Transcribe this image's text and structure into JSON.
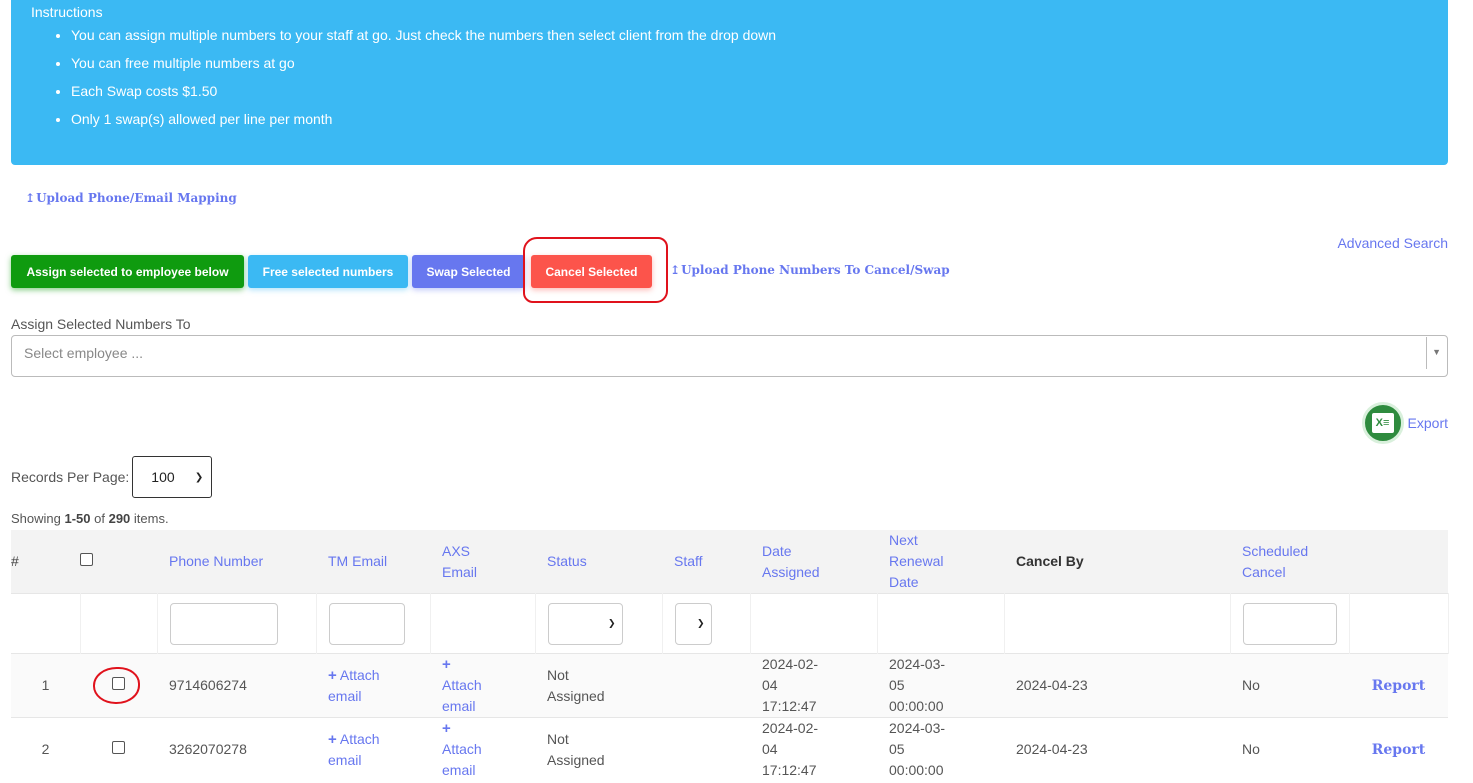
{
  "instructions": {
    "title": "Instructions",
    "items": [
      "You can assign multiple numbers to your staff at go. Just check the numbers then select client from the drop down",
      "You can free multiple numbers at go",
      "Each Swap costs $1.50",
      "Only 1 swap(s) allowed per line per month"
    ]
  },
  "links": {
    "upload_mapping": "Upload Phone/Email Mapping",
    "upload_cancel_swap": "Upload Phone Numbers To Cancel/Swap",
    "advanced_search": "Advanced Search",
    "export": "Export"
  },
  "buttons": {
    "assign": "Assign selected to employee below",
    "free": "Free selected numbers",
    "swap": "Swap Selected",
    "cancel": "Cancel Selected"
  },
  "assign_field": {
    "label": "Assign Selected Numbers To",
    "placeholder": "Select employee ..."
  },
  "records_per_page": {
    "label": "Records Per Page:",
    "value": "100"
  },
  "summary": {
    "prefix": "Showing ",
    "range": "1-50",
    "of": " of ",
    "total": "290",
    "suffix": " items."
  },
  "table": {
    "headers": {
      "num": "#",
      "phone": "Phone Number",
      "tm_email": "TM Email",
      "axs_email_1": "AXS",
      "axs_email_2": "Email",
      "status": "Status",
      "staff": "Staff",
      "date_assigned_1": "Date",
      "date_assigned_2": "Assigned",
      "next_renewal_1": "Next",
      "next_renewal_2": "Renewal",
      "next_renewal_3": "Date",
      "cancel_by": "Cancel By",
      "scheduled_cancel_1": "Scheduled",
      "scheduled_cancel_2": "Cancel"
    },
    "rows": [
      {
        "num": "1",
        "phone": "9714606274",
        "tm_email_1": "Attach",
        "tm_email_2": "email",
        "axs_email_1": "Attach",
        "axs_email_2": "email",
        "status_1": "Not",
        "status_2": "Assigned",
        "date_assigned_1": "2024-02-",
        "date_assigned_2": "04",
        "date_assigned_3": "17:12:47",
        "next_renewal_1": "2024-03-",
        "next_renewal_2": "05",
        "next_renewal_3": "00:00:00",
        "cancel_by": "2024-04-23",
        "scheduled_cancel": "No",
        "action": "Report"
      },
      {
        "num": "2",
        "phone": "3262070278",
        "tm_email_1": "Attach",
        "tm_email_2": "email",
        "axs_email_1": "Attach",
        "axs_email_2": "email",
        "status_1": "Not",
        "status_2": "Assigned",
        "date_assigned_1": "2024-02-",
        "date_assigned_2": "04",
        "date_assigned_3": "17:12:47",
        "next_renewal_1": "2024-03-",
        "next_renewal_2": "05",
        "next_renewal_3": "00:00:00",
        "cancel_by": "2024-04-23",
        "scheduled_cancel": "No",
        "action": "Report"
      }
    ]
  },
  "colors": {
    "info_banner": "#3bb9f3",
    "assign": "#0f9b0f",
    "free": "#3bb9f3",
    "swap": "#6777ef",
    "cancel": "#fc544b",
    "link": "#6777ef",
    "annotation": "#e0121c"
  }
}
